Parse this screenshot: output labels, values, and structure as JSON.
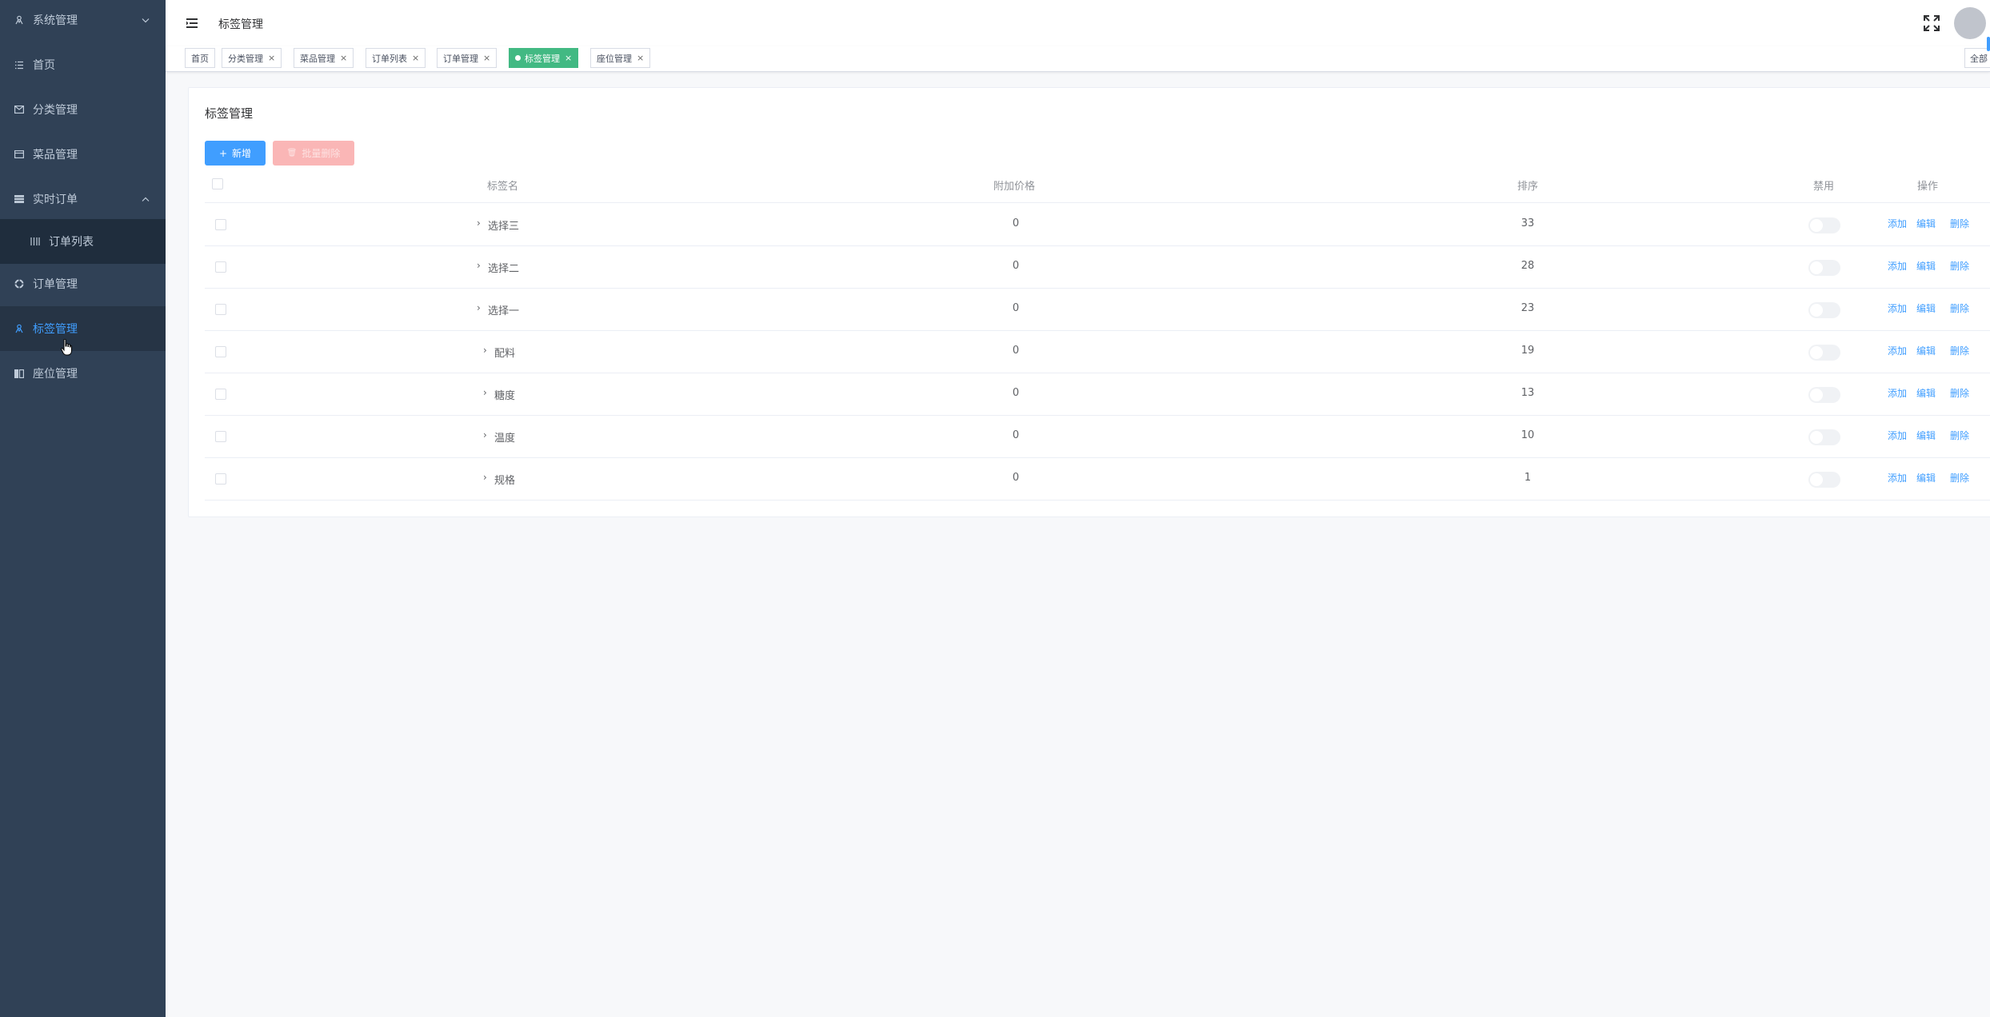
{
  "sidebar": {
    "items": [
      {
        "icon": "user-icon",
        "label": "系统管理",
        "arrow": "chevron-down-icon"
      },
      {
        "icon": "list-icon",
        "label": "首页"
      },
      {
        "icon": "envelope-icon",
        "label": "分类管理"
      },
      {
        "icon": "card-icon",
        "label": "菜品管理"
      },
      {
        "icon": "table-icon",
        "label": "实时订单",
        "arrow": "chevron-up-icon"
      },
      {
        "icon": "grid-icon",
        "label": "订单列表"
      },
      {
        "icon": "ring-icon",
        "label": "订单管理"
      },
      {
        "icon": "user-icon",
        "label": "标签管理"
      },
      {
        "icon": "book-icon",
        "label": "座位管理"
      }
    ]
  },
  "navbar": {
    "title": "标签管理"
  },
  "tags": [
    {
      "label": "首页",
      "closable": false
    },
    {
      "label": "分类管理",
      "closable": true
    },
    {
      "label": "菜品管理",
      "closable": true
    },
    {
      "label": "订单列表",
      "closable": true
    },
    {
      "label": "订单管理",
      "closable": true
    },
    {
      "label": "标签管理",
      "closable": true
    },
    {
      "label": "座位管理",
      "closable": true
    }
  ],
  "close_all_label": "全部",
  "close_symbol": "×",
  "page": {
    "title": "标签管理",
    "add_button": "新增",
    "add_symbol": "+",
    "batch_delete_button": "批量删除",
    "batch_delete_symbol": "🗑"
  },
  "table": {
    "columns": [
      "标签名",
      "附加价格",
      "排序",
      "禁用",
      "操作"
    ],
    "expand_symbol": "›",
    "rows": [
      {
        "name": "选择三",
        "price": "0",
        "sort": "33"
      },
      {
        "name": "选择二",
        "price": "0",
        "sort": "28"
      },
      {
        "name": "选择一",
        "price": "0",
        "sort": "23"
      },
      {
        "name": "配料",
        "price": "0",
        "sort": "19"
      },
      {
        "name": "糖度",
        "price": "0",
        "sort": "13"
      },
      {
        "name": "温度",
        "price": "0",
        "sort": "10"
      },
      {
        "name": "规格",
        "price": "0",
        "sort": "1"
      }
    ],
    "actions": {
      "add": "添加",
      "edit": "编辑",
      "delete": "删除"
    }
  },
  "colors": {
    "sidebar_bg": "#304156",
    "active_text": "#409eff",
    "active_tag": "#42b983",
    "primary": "#409eff",
    "danger_disabled": "#fab6b6"
  }
}
